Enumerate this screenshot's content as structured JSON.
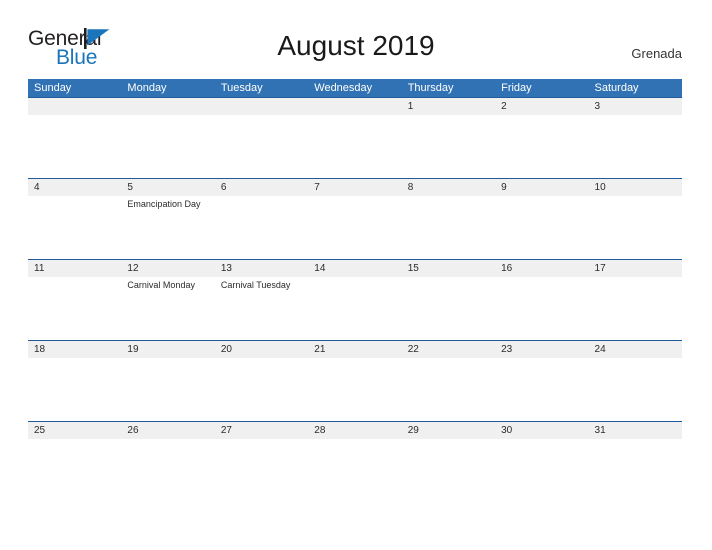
{
  "brand": {
    "name_part1": "General",
    "name_part2": "Blue",
    "flag_icon": "triangle-flag-icon",
    "color_dark": "#231f20",
    "color_blue": "#1b75bb"
  },
  "header": {
    "title": "August 2019",
    "region": "Grenada"
  },
  "theme": {
    "header_band": "#3072b3",
    "row_separator": "#1f5c99",
    "date_band": "#f0f0f0",
    "page_background": "#ffffff",
    "text": "#2b2b2b"
  },
  "calendar": {
    "weekdays": [
      "Sunday",
      "Monday",
      "Tuesday",
      "Wednesday",
      "Thursday",
      "Friday",
      "Saturday"
    ],
    "weeks": [
      {
        "dates": [
          "",
          "",
          "",
          "",
          "1",
          "2",
          "3"
        ],
        "events": [
          "",
          "",
          "",
          "",
          "",
          "",
          ""
        ]
      },
      {
        "dates": [
          "4",
          "5",
          "6",
          "7",
          "8",
          "9",
          "10"
        ],
        "events": [
          "",
          "Emancipation Day",
          "",
          "",
          "",
          "",
          ""
        ]
      },
      {
        "dates": [
          "11",
          "12",
          "13",
          "14",
          "15",
          "16",
          "17"
        ],
        "events": [
          "",
          "Carnival Monday",
          "Carnival Tuesday",
          "",
          "",
          "",
          ""
        ]
      },
      {
        "dates": [
          "18",
          "19",
          "20",
          "21",
          "22",
          "23",
          "24"
        ],
        "events": [
          "",
          "",
          "",
          "",
          "",
          "",
          ""
        ]
      },
      {
        "dates": [
          "25",
          "26",
          "27",
          "28",
          "29",
          "30",
          "31"
        ],
        "events": [
          "",
          "",
          "",
          "",
          "",
          "",
          ""
        ]
      }
    ]
  }
}
